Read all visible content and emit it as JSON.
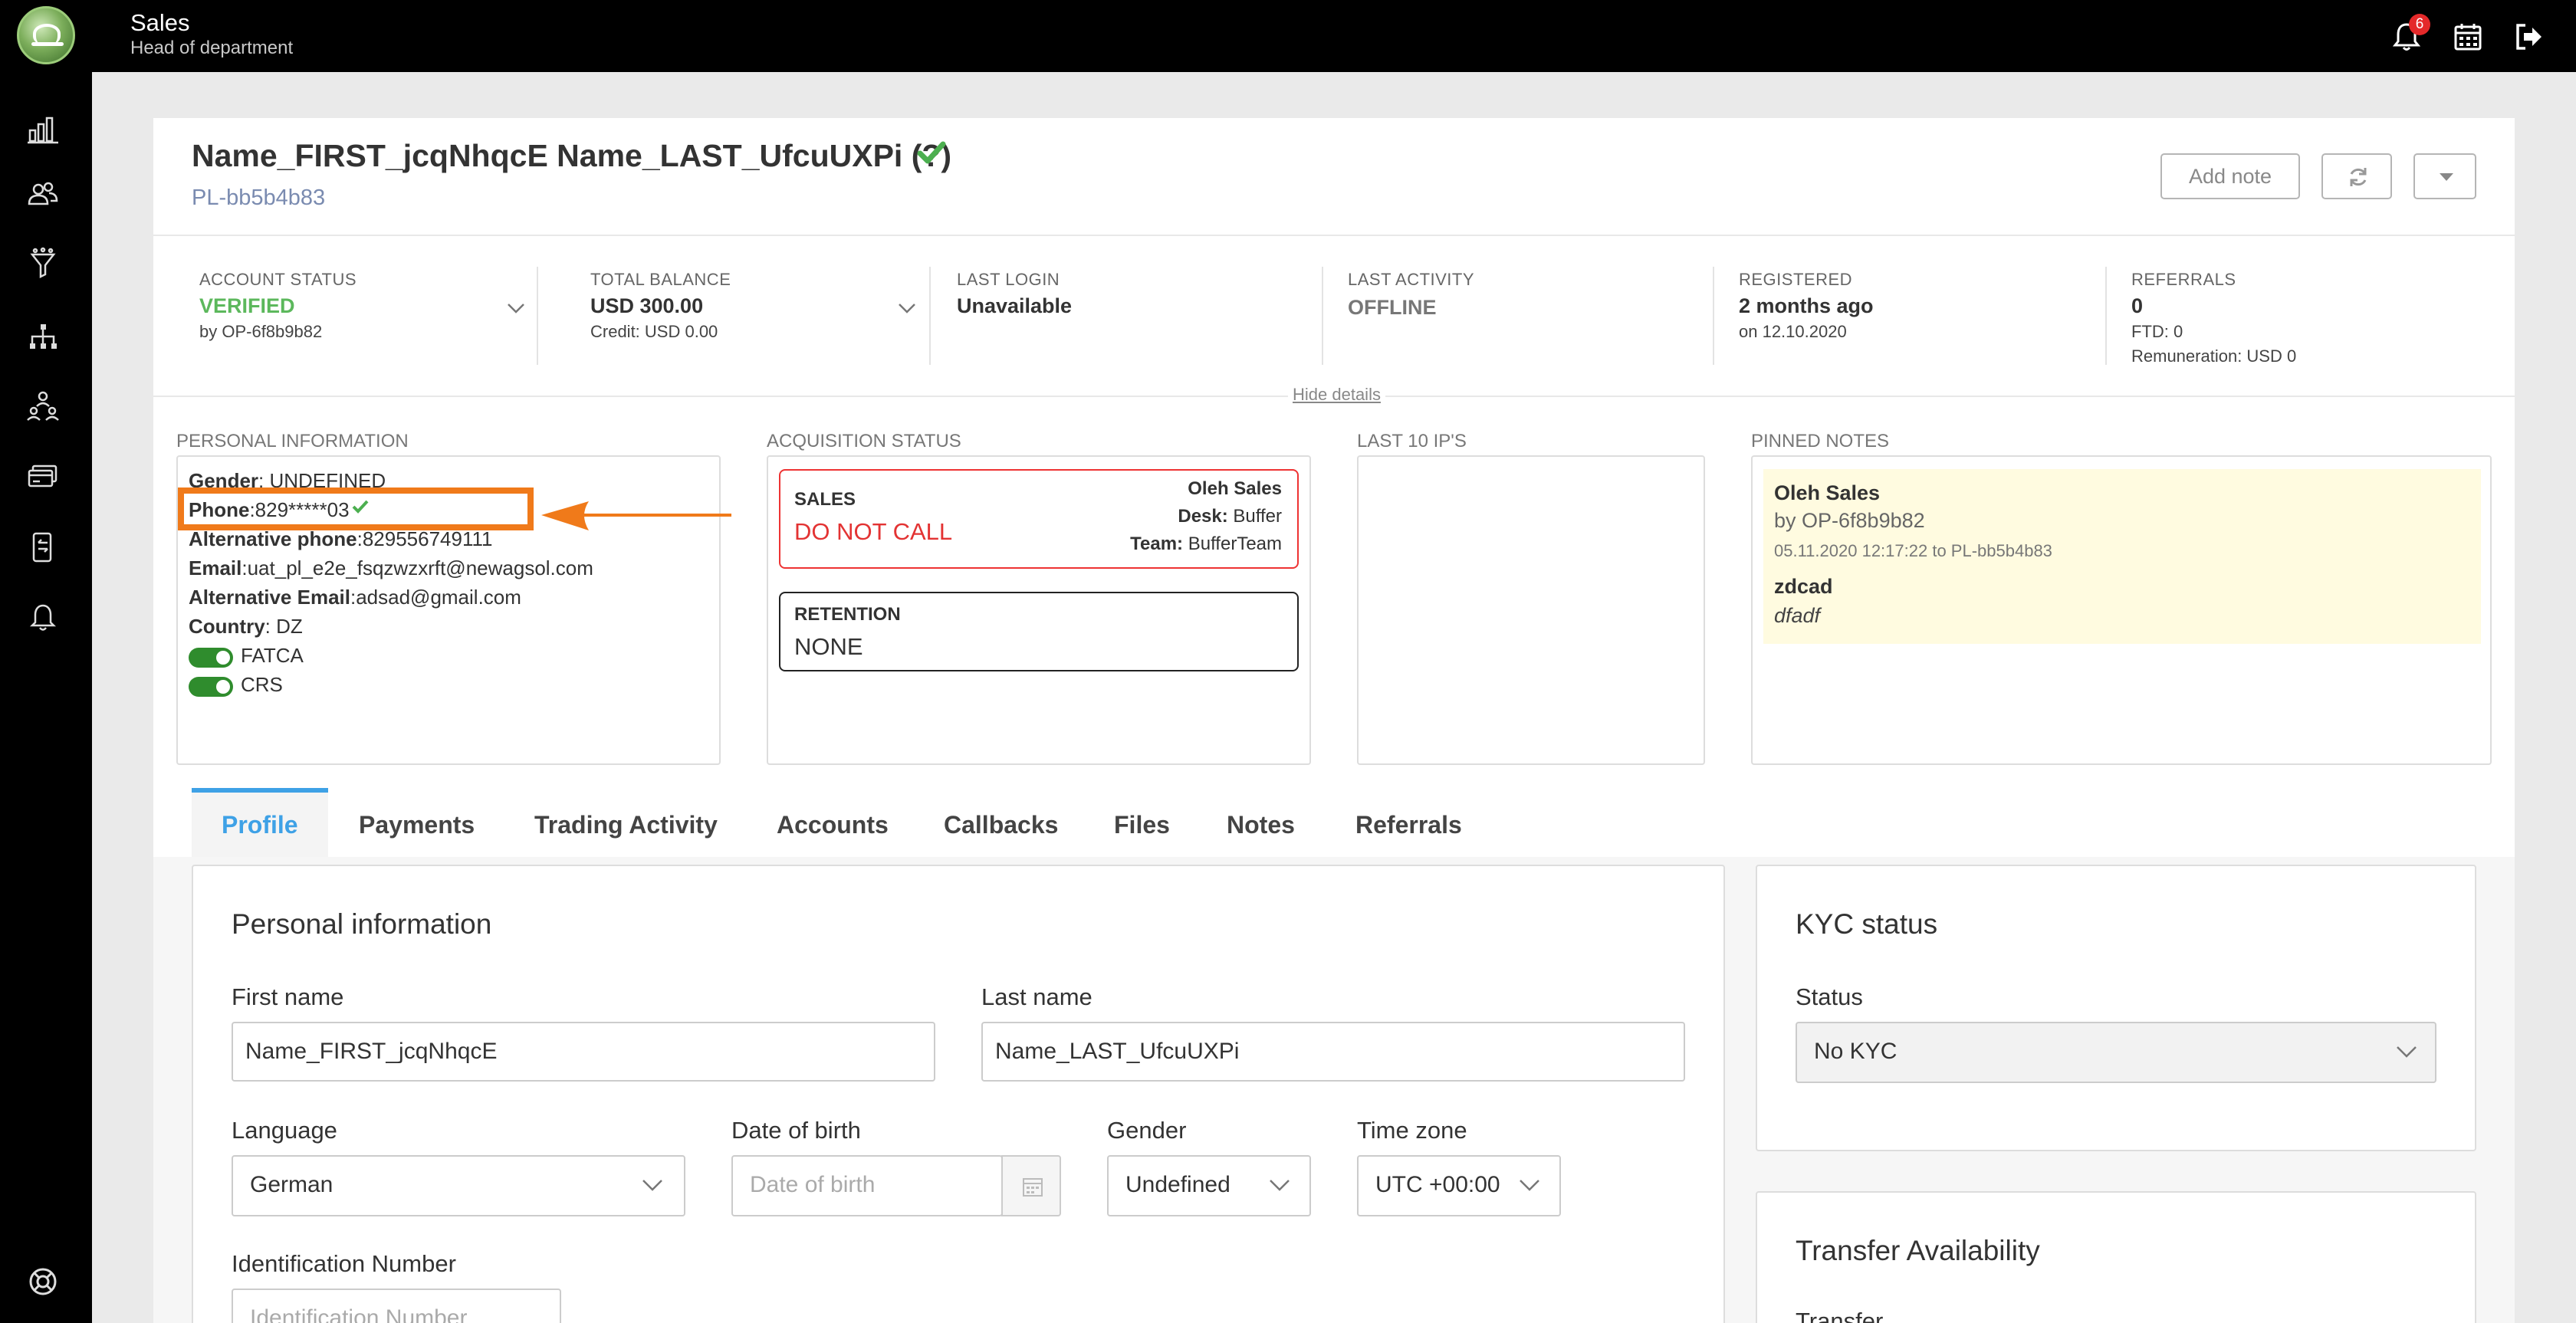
{
  "app": {
    "title": "Sales",
    "subtitle": "Head of department",
    "notification_count": "6"
  },
  "client": {
    "name": "Name_FIRST_jcqNhqcE Name_LAST_UfcuUXPi (?)",
    "id": "PL-bb5b4b83"
  },
  "header_buttons": {
    "add_note": "Add note"
  },
  "stats": [
    {
      "label": "ACCOUNT STATUS",
      "value": "VERIFIED",
      "sub": "by OP-6f8b9b82"
    },
    {
      "label": "TOTAL BALANCE",
      "value": "USD 300.00",
      "sub": "Credit: USD 0.00"
    },
    {
      "label": "LAST LOGIN",
      "value": "Unavailable"
    },
    {
      "label": "LAST ACTIVITY",
      "value": "OFFLINE"
    },
    {
      "label": "REGISTERED",
      "value": "2 months ago",
      "sub": "on 12.10.2020"
    },
    {
      "label": "REFERRALS",
      "value": "0",
      "sub": "FTD: 0",
      "sub2": "Remuneration: USD 0"
    }
  ],
  "hide_details": "Hide details",
  "personal_info": {
    "label": "PERSONAL INFORMATION",
    "gender_key": "Gender",
    "gender_value": ": UNDEFINED",
    "phone_key": "Phone",
    "phone_value": ":829*****03",
    "alt_phone_key": "Alternative phone",
    "alt_phone_value": ":829556749111",
    "email_key": "Email",
    "email_value": ":uat_pl_e2e_fsqzwzxrft@newagsol.com",
    "alt_email_key": "Alternative Email",
    "alt_email_value": ":adsad@gmail.com",
    "country_key": "Country",
    "country_value": ": DZ",
    "fatca": "FATCA",
    "crs": "CRS"
  },
  "acquisition": {
    "label": "ACQUISITION STATUS",
    "sales_title": "SALES",
    "sales_status": "DO NOT CALL",
    "sales_owner": "Oleh Sales",
    "desk_key": "Desk:",
    "desk_value": " Buffer",
    "team_key": "Team:",
    "team_value": " BufferTeam",
    "retention_title": "RETENTION",
    "retention_status": "NONE"
  },
  "last_ips": {
    "label": "LAST 10 IP'S"
  },
  "pinned_notes": {
    "label": "PINNED NOTES",
    "author": "Oleh Sales",
    "by": "by OP-6f8b9b82",
    "meta": "05.11.2020 12:17:22 to PL-bb5b4b83",
    "subject": "zdcad",
    "body": "dfadf"
  },
  "tabs": [
    {
      "label": "Profile"
    },
    {
      "label": "Payments"
    },
    {
      "label": "Trading Activity"
    },
    {
      "label": "Accounts"
    },
    {
      "label": "Callbacks"
    },
    {
      "label": "Files"
    },
    {
      "label": "Notes"
    },
    {
      "label": "Referrals"
    }
  ],
  "personal_form": {
    "title": "Personal information",
    "first_name_label": "First name",
    "first_name_value": "Name_FIRST_jcqNhqcE",
    "last_name_label": "Last name",
    "last_name_value": "Name_LAST_UfcuUXPi",
    "language_label": "Language",
    "language_value": "German",
    "dob_label": "Date of birth",
    "dob_placeholder": "Date of birth",
    "gender_label": "Gender",
    "gender_value": "Undefined",
    "timezone_label": "Time zone",
    "timezone_value": "UTC +00:00",
    "id_number_label": "Identification Number",
    "id_number_placeholder": "Identification Number"
  },
  "kyc": {
    "title": "KYC status",
    "status_label": "Status",
    "status_value": "No KYC"
  },
  "transfer": {
    "title": "Transfer Availability",
    "sub_label": "Transfer"
  },
  "colors": {
    "accent": "#3ea1e6",
    "verified_green": "#4caf50",
    "danger_red": "#e33333",
    "highlight_orange": "#f07a1a"
  }
}
